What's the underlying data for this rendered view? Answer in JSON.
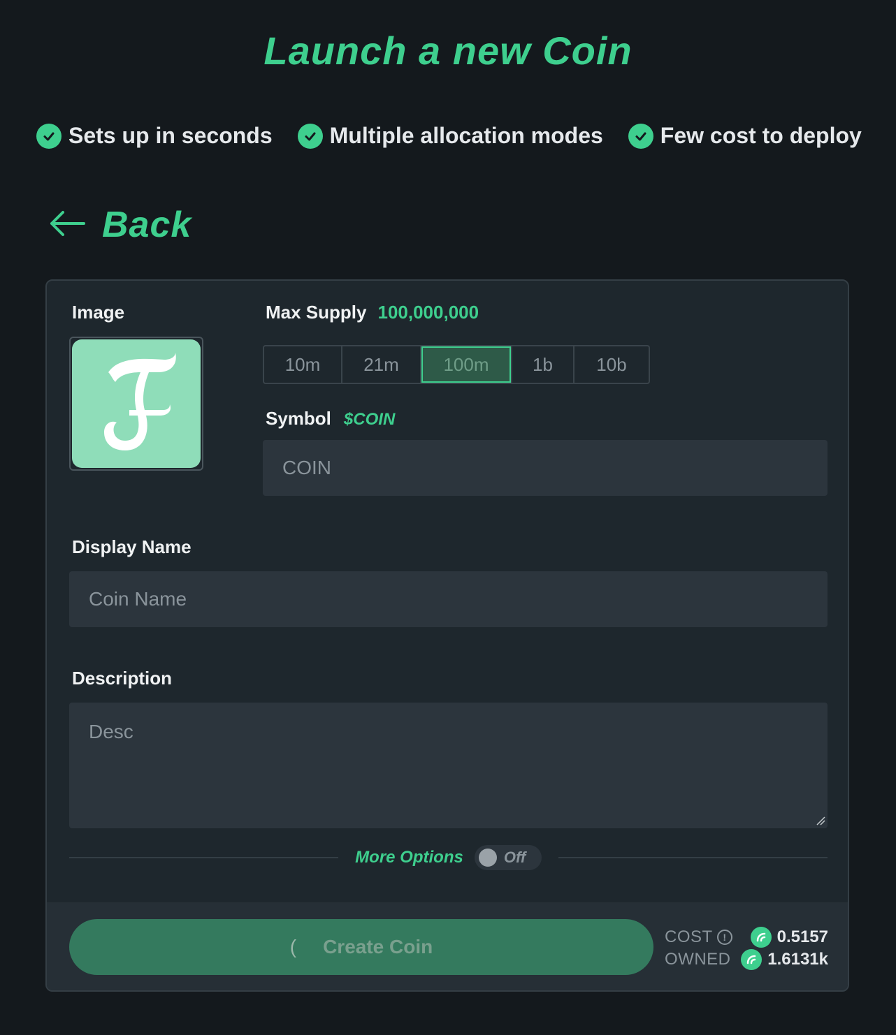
{
  "header": {
    "title": "Launch a new Coin"
  },
  "features": [
    {
      "label": "Sets up in seconds",
      "icon": "check-circle-icon"
    },
    {
      "label": "Multiple allocation modes",
      "icon": "check-circle-icon"
    },
    {
      "label": "Few cost to deploy",
      "icon": "check-circle-icon"
    }
  ],
  "nav": {
    "back_label": "Back"
  },
  "form": {
    "image_label": "Image",
    "max_supply_label": "Max Supply",
    "max_supply_value": "100,000,000",
    "supply_options": [
      "10m",
      "21m",
      "100m",
      "1b",
      "10b"
    ],
    "supply_selected": "100m",
    "symbol_label": "Symbol",
    "symbol_tag": "$COIN",
    "symbol_placeholder": "COIN",
    "display_name_label": "Display Name",
    "display_name_placeholder": "Coin Name",
    "description_label": "Description",
    "description_placeholder": "Desc",
    "more_options_label": "More Options",
    "more_options_state": "Off"
  },
  "footer": {
    "create_label": "Create Coin",
    "cost_label": "COST",
    "cost_value": "0.5157",
    "owned_label": "OWNED",
    "owned_value": "1.6131k"
  },
  "colors": {
    "accent": "#3ecf8e",
    "background": "#14191d",
    "card": "#1e272d"
  }
}
